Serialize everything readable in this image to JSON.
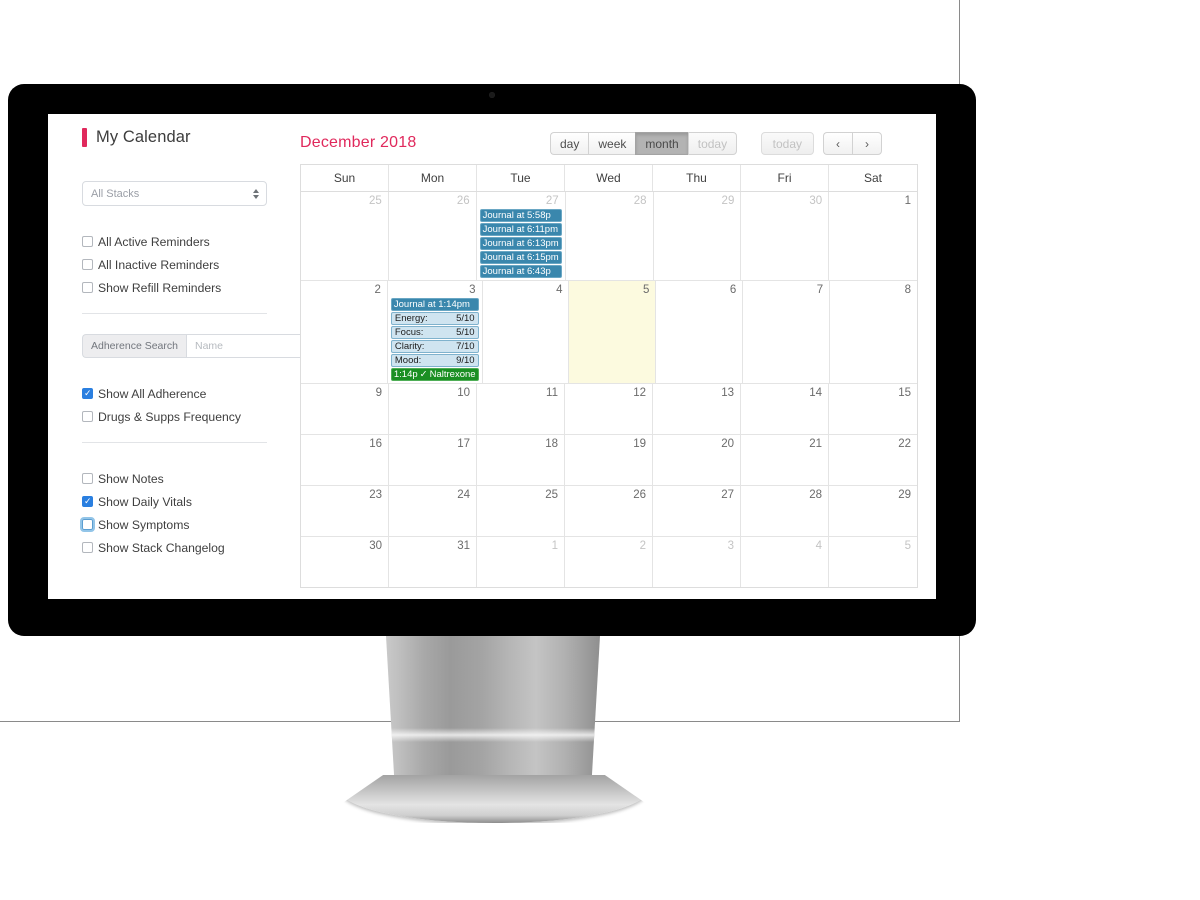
{
  "background": {
    "guide_line_color": "#8a8a8a"
  },
  "device": {
    "name": "apple-display",
    "bezel_color": "#000000",
    "logo_glyph": "",
    "camera": "camera-dot"
  },
  "sidebar": {
    "app_title": "My Calendar",
    "accent_color": "#e0295c",
    "stack_select": {
      "value": "All Stacks",
      "icon": "spinner-arrows-icon"
    },
    "reminder_checkboxes": [
      {
        "label": "All Active Reminders",
        "checked": false,
        "focused": false
      },
      {
        "label": "All Inactive Reminders",
        "checked": false,
        "focused": false
      },
      {
        "label": "Show Refill Reminders",
        "checked": false,
        "focused": false
      }
    ],
    "adherence_search": {
      "addon_label": "Adherence Search",
      "placeholder": "Name",
      "value": ""
    },
    "adherence_checkboxes": [
      {
        "label": "Show All Adherence",
        "checked": true,
        "focused": false
      },
      {
        "label": "Drugs & Supps Frequency",
        "checked": false,
        "focused": false
      }
    ],
    "display_checkboxes": [
      {
        "label": "Show Notes",
        "checked": false,
        "focused": false
      },
      {
        "label": "Show Daily Vitals",
        "checked": true,
        "focused": false
      },
      {
        "label": "Show Symptoms",
        "checked": false,
        "focused": true
      },
      {
        "label": "Show Stack Changelog",
        "checked": false,
        "focused": false
      }
    ]
  },
  "calendar": {
    "title": "December 2018",
    "view_buttons": [
      {
        "label": "day",
        "active": false,
        "disabled": false
      },
      {
        "label": "week",
        "active": false,
        "disabled": false
      },
      {
        "label": "month",
        "active": true,
        "disabled": false
      },
      {
        "label": "today",
        "active": false,
        "disabled": true
      }
    ],
    "today_button": {
      "label": "today",
      "disabled": true
    },
    "nav_buttons": [
      {
        "label": "‹",
        "name": "prev-month-button"
      },
      {
        "label": "›",
        "name": "next-month-button"
      }
    ],
    "day_headers": [
      "Sun",
      "Mon",
      "Tue",
      "Wed",
      "Thu",
      "Fri",
      "Sat"
    ],
    "weeks": [
      [
        {
          "day": "25",
          "other": true,
          "today": false,
          "events": []
        },
        {
          "day": "26",
          "other": true,
          "today": false,
          "events": []
        },
        {
          "day": "27",
          "other": true,
          "today": false,
          "events": [
            {
              "type": "journal",
              "text": "Journal at 5:58p"
            },
            {
              "type": "journal",
              "text": "Journal at 6:11pm"
            },
            {
              "type": "journal",
              "text": "Journal at 6:13pm"
            },
            {
              "type": "journal",
              "text": "Journal at 6:15pm"
            },
            {
              "type": "journal",
              "text": "Journal at 6:43p"
            }
          ]
        },
        {
          "day": "28",
          "other": true,
          "today": false,
          "events": []
        },
        {
          "day": "29",
          "other": true,
          "today": false,
          "events": []
        },
        {
          "day": "30",
          "other": true,
          "today": false,
          "events": []
        },
        {
          "day": "1",
          "other": false,
          "today": false,
          "events": []
        }
      ],
      [
        {
          "day": "2",
          "other": false,
          "today": false,
          "events": []
        },
        {
          "day": "3",
          "other": false,
          "today": false,
          "events": [
            {
              "type": "journal",
              "text": "Journal at 1:14pm"
            },
            {
              "type": "vital",
              "label": "Energy:",
              "value": "5/10"
            },
            {
              "type": "vital",
              "label": "Focus:",
              "value": "5/10"
            },
            {
              "type": "vital",
              "label": "Clarity:",
              "value": "7/10"
            },
            {
              "type": "vital",
              "label": "Mood:",
              "value": "9/10"
            },
            {
              "type": "med",
              "time": "1:14p",
              "tick": "✓",
              "name": "Naltrexone"
            }
          ]
        },
        {
          "day": "4",
          "other": false,
          "today": false,
          "events": []
        },
        {
          "day": "5",
          "other": false,
          "today": true,
          "events": []
        },
        {
          "day": "6",
          "other": false,
          "today": false,
          "events": []
        },
        {
          "day": "7",
          "other": false,
          "today": false,
          "events": []
        },
        {
          "day": "8",
          "other": false,
          "today": false,
          "events": []
        }
      ],
      [
        {
          "day": "9",
          "other": false,
          "today": false,
          "events": []
        },
        {
          "day": "10",
          "other": false,
          "today": false,
          "events": []
        },
        {
          "day": "11",
          "other": false,
          "today": false,
          "events": []
        },
        {
          "day": "12",
          "other": false,
          "today": false,
          "events": []
        },
        {
          "day": "13",
          "other": false,
          "today": false,
          "events": []
        },
        {
          "day": "14",
          "other": false,
          "today": false,
          "events": []
        },
        {
          "day": "15",
          "other": false,
          "today": false,
          "events": []
        }
      ],
      [
        {
          "day": "16",
          "other": false,
          "today": false,
          "events": []
        },
        {
          "day": "17",
          "other": false,
          "today": false,
          "events": []
        },
        {
          "day": "18",
          "other": false,
          "today": false,
          "events": []
        },
        {
          "day": "19",
          "other": false,
          "today": false,
          "events": []
        },
        {
          "day": "20",
          "other": false,
          "today": false,
          "events": []
        },
        {
          "day": "21",
          "other": false,
          "today": false,
          "events": []
        },
        {
          "day": "22",
          "other": false,
          "today": false,
          "events": []
        }
      ],
      [
        {
          "day": "23",
          "other": false,
          "today": false,
          "events": []
        },
        {
          "day": "24",
          "other": false,
          "today": false,
          "events": []
        },
        {
          "day": "25",
          "other": false,
          "today": false,
          "events": []
        },
        {
          "day": "26",
          "other": false,
          "today": false,
          "events": []
        },
        {
          "day": "27",
          "other": false,
          "today": false,
          "events": []
        },
        {
          "day": "28",
          "other": false,
          "today": false,
          "events": []
        },
        {
          "day": "29",
          "other": false,
          "today": false,
          "events": []
        }
      ],
      [
        {
          "day": "30",
          "other": false,
          "today": false,
          "events": []
        },
        {
          "day": "31",
          "other": false,
          "today": false,
          "events": []
        },
        {
          "day": "1",
          "other": true,
          "today": false,
          "events": []
        },
        {
          "day": "2",
          "other": true,
          "today": false,
          "events": []
        },
        {
          "day": "3",
          "other": true,
          "today": false,
          "events": []
        },
        {
          "day": "4",
          "other": true,
          "today": false,
          "events": []
        },
        {
          "day": "5",
          "other": true,
          "today": false,
          "events": []
        }
      ]
    ]
  },
  "colors": {
    "accent": "#e0295c",
    "journal_event": "#3a87ad",
    "vital_event": "#cfe4f0",
    "med_event": "#1a8f23",
    "today_cell": "#fcfadf",
    "checkbox_on": "#2a7fe0"
  }
}
